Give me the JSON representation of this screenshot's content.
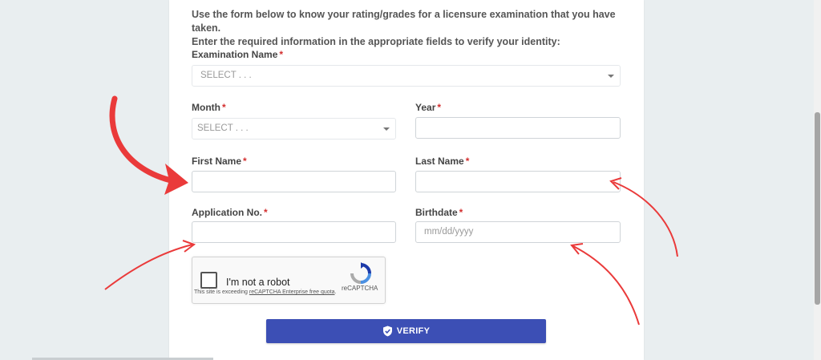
{
  "intro": {
    "line1": "Use the form below to know your rating/grades for a licensure examination that you have taken.",
    "line2": "Enter the required information in the appropriate fields to verify your identity:"
  },
  "form": {
    "required_marker": "*",
    "exam_name": {
      "label": "Examination Name",
      "value": "SELECT . . ."
    },
    "month": {
      "label": "Month",
      "value": "SELECT . . ."
    },
    "year": {
      "label": "Year",
      "value": ""
    },
    "first_name": {
      "label": "First Name",
      "value": ""
    },
    "last_name": {
      "label": "Last Name",
      "value": ""
    },
    "application_no": {
      "label": "Application No.",
      "value": ""
    },
    "birthdate": {
      "label": "Birthdate",
      "placeholder": "mm/dd/yyyy"
    }
  },
  "captcha": {
    "label": "I'm not a robot",
    "brand": "reCAPTCHA",
    "note_prefix": "This site is exceeding ",
    "note_link": "reCAPTCHA Enterprise free quota",
    "note_suffix": "."
  },
  "verify_button": {
    "label": "VERIFY",
    "icon": "shield-check-icon"
  },
  "colors": {
    "primary": "#3c4fb5",
    "required": "#d32f2f",
    "annotation_arrow": "#ea3a3a",
    "background": "#e9eef0"
  }
}
